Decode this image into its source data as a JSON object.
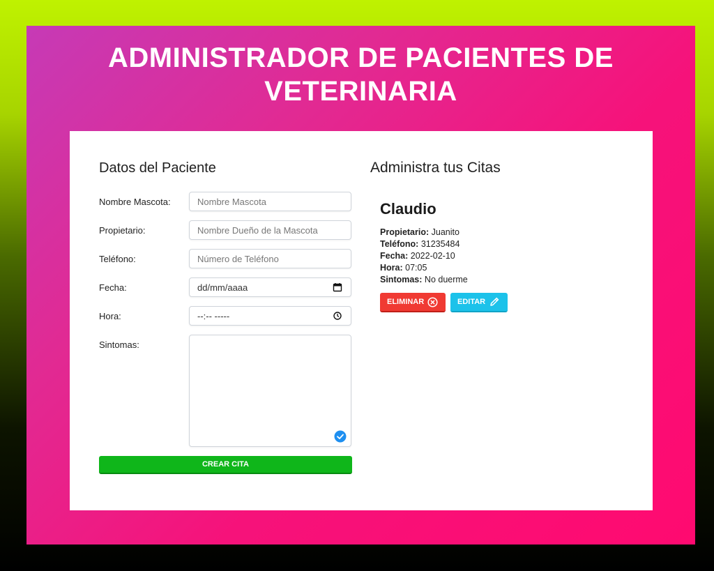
{
  "header": {
    "title": "ADMINISTRADOR DE PACIENTES DE VETERINARIA"
  },
  "form": {
    "heading": "Datos del Paciente",
    "fields": [
      {
        "label": "Nombre Mascota:",
        "placeholder": "Nombre Mascota"
      },
      {
        "label": "Propietario:",
        "placeholder": "Nombre Dueño de la Mascota"
      },
      {
        "label": "Teléfono:",
        "placeholder": "Número de Teléfono"
      },
      {
        "label": "Fecha:",
        "placeholder": "dd/mm/aaaa"
      },
      {
        "label": "Hora:",
        "placeholder": "--:-- -----"
      },
      {
        "label": "Sintomas:",
        "placeholder": ""
      }
    ],
    "submit_label": "CREAR CITA"
  },
  "citas": {
    "heading": "Administra tus Citas",
    "items": [
      {
        "name": "Claudio",
        "rows": [
          {
            "key": "Propietario:",
            "value": "Juanito"
          },
          {
            "key": "Teléfono:",
            "value": "31235484"
          },
          {
            "key": "Fecha:",
            "value": "2022-02-10"
          },
          {
            "key": "Hora:",
            "value": "07:05"
          },
          {
            "key": "Sintomas:",
            "value": "No duerme"
          }
        ],
        "delete_label": "ELIMINAR",
        "edit_label": "EDITAR"
      }
    ]
  },
  "colors": {
    "delete": "#f03a33",
    "edit": "#1cc2ea",
    "submit": "#0fb61a",
    "accent": "#ff0a70"
  },
  "icons": [
    "calendar-icon",
    "clock-icon",
    "check-circle-icon",
    "x-circle-icon",
    "pencil-icon"
  ]
}
